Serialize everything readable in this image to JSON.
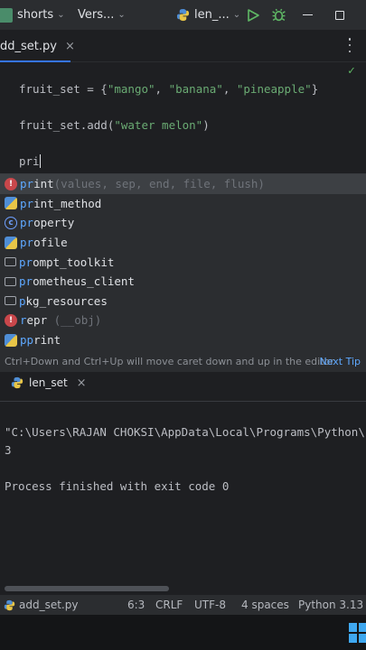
{
  "titlebar": {
    "project": "shorts",
    "vcs": "Vers...",
    "run_config": "len_..."
  },
  "editor": {
    "tab_label": "dd_set.py",
    "lines": {
      "l1_pre": "fruit_set = {",
      "l1_s1": "\"mango\"",
      "l1_sep1": ", ",
      "l1_s2": "\"banana\"",
      "l1_sep2": ", ",
      "l1_s3": "\"pineapple\"",
      "l1_post": "}",
      "l2_pre": "fruit_set.add(",
      "l2_s1": "\"water melon\"",
      "l2_post": ")",
      "l3": "pri"
    }
  },
  "completion": {
    "items": [
      {
        "match": "pr",
        "rest": "int",
        "hint": "(values, sep, end, file, flush)"
      },
      {
        "match": "pr",
        "rest": "int_method",
        "hint": ""
      },
      {
        "match": "pr",
        "rest": "operty",
        "hint": ""
      },
      {
        "match": "pr",
        "rest": "ofile",
        "hint": ""
      },
      {
        "match": "pr",
        "rest": "ompt_toolkit",
        "hint": ""
      },
      {
        "match": "pr",
        "rest": "ometheus_client",
        "hint": ""
      },
      {
        "match": "p",
        "rest": "kg_resources",
        "hint": ""
      },
      {
        "match": "r",
        "rest": "epr",
        "hint": " (__obj)"
      },
      {
        "match": "pp",
        "rest": "rint",
        "hint": ""
      }
    ],
    "tip_text": "Ctrl+Down and Ctrl+Up will move caret down and up in the editor",
    "next_tip": "Next Tip"
  },
  "run": {
    "tab_label": "len_set",
    "output": [
      "\"C:\\Users\\RAJAN CHOKSI\\AppData\\Local\\Programs\\Python\\P",
      "3",
      "",
      "Process finished with exit code 0"
    ]
  },
  "statusbar": {
    "file": "add_set.py",
    "position": "6:3",
    "line_sep": "CRLF",
    "encoding": "UTF-8",
    "indent": "4 spaces",
    "interpreter": "Python 3.13"
  },
  "colors": {
    "accent": "#3574f0",
    "string": "#6aab73",
    "match": "#5ea8ff",
    "run_green": "#5fb865"
  }
}
